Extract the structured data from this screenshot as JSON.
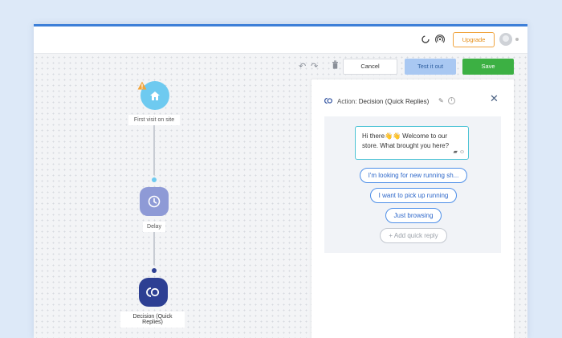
{
  "topbar": {
    "upgrade_label": "Upgrade",
    "icons": [
      "loading-icon",
      "broadcast-icon",
      "avatar",
      "dropdown-icon"
    ]
  },
  "toolbar": {
    "undo_icon": "↶",
    "redo_icon": "↷",
    "delete_icon": "🗑",
    "cancel_label": "Cancel",
    "test_label": "Test it out",
    "save_label": "Save"
  },
  "flow": {
    "nodes": [
      {
        "label": "First visit on site",
        "icon": "home-icon",
        "color": "#6ecaf0",
        "warning": true
      },
      {
        "label": "Delay",
        "icon": "clock-icon",
        "color": "#8e9ad6"
      },
      {
        "label": "Decision (Quick Replies)",
        "icon": "quick-replies-icon",
        "color": "#2d3f93"
      }
    ],
    "connector_dot_colors": [
      "#6ecaf0",
      "#2d3f93"
    ]
  },
  "panel": {
    "title_prefix": "Action:",
    "title": "Decision (Quick Replies)",
    "message": "Hi there👋👋 Welcome to our store. What brought you here?",
    "quick_replies": [
      "I'm looking for new running sh...",
      "I want to pick up running",
      "Just browsing"
    ],
    "add_reply_label": "+ Add quick reply"
  },
  "colors": {
    "accent": "#3d7fd8",
    "save": "#3cb043",
    "upgrade": "#e58d16"
  }
}
